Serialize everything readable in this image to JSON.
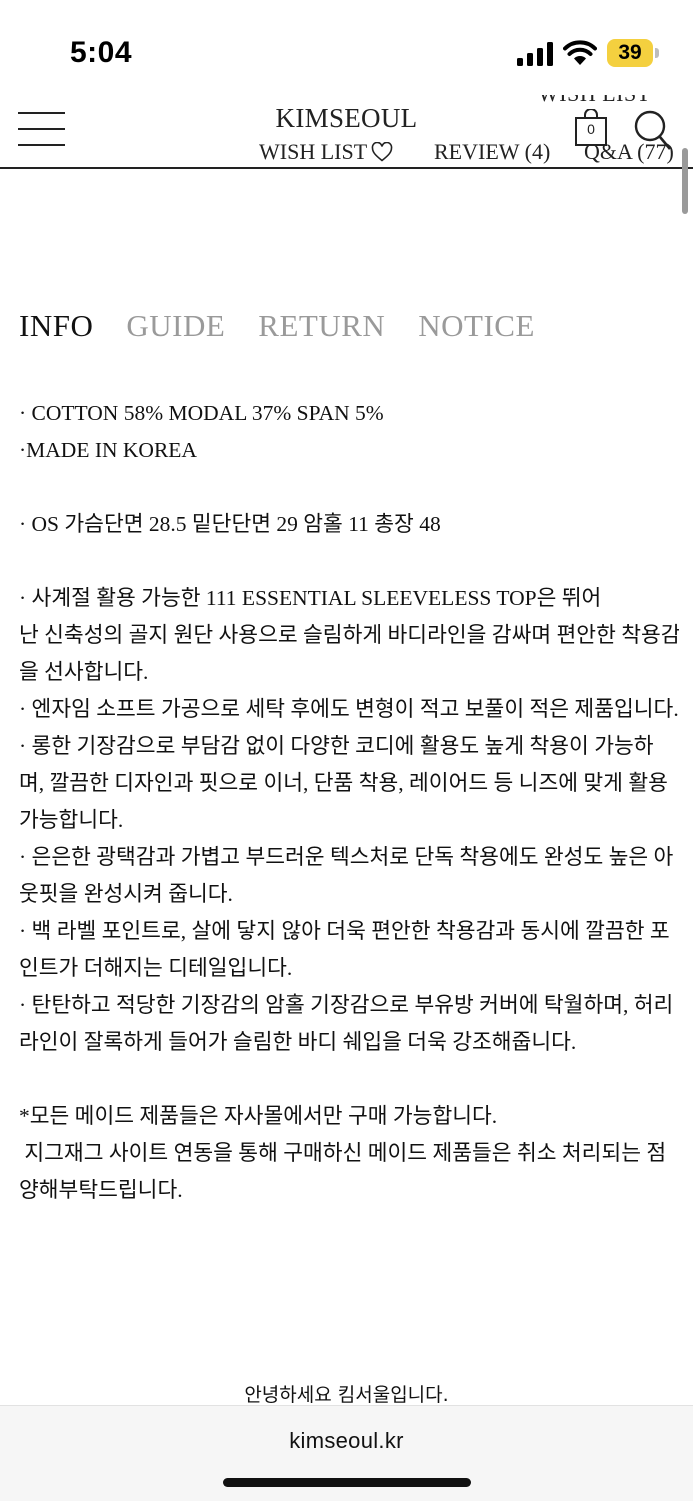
{
  "status_bar": {
    "time": "5:04",
    "battery_level": "39",
    "icons": [
      "signal-icon",
      "wifi-icon",
      "battery-icon"
    ]
  },
  "header": {
    "overflow_label": "WISH LIST",
    "brand": "KIMSEOUL",
    "cart_count": "0",
    "tabs": [
      {
        "label": "WISH LIST"
      },
      {
        "label": "REVIEW (4)"
      },
      {
        "label": "Q&A (77)"
      }
    ],
    "icons": [
      "menu-icon",
      "heart-icon",
      "cart-icon",
      "search-icon"
    ]
  },
  "info_tabs": [
    {
      "label": "INFO",
      "active": true
    },
    {
      "label": "GUIDE",
      "active": false
    },
    {
      "label": "RETURN",
      "active": false
    },
    {
      "label": "NOTICE",
      "active": false
    }
  ],
  "product_info": {
    "lines": [
      "· COTTON 58% MODAL 37% SPAN 5%",
      "·MADE IN KOREA",
      "",
      "· OS 가슴단면 28.5 밑단단면 29 암홀 11  총장 48",
      "",
      "· 사계절 활용 가능한 111 ESSENTIAL SLEEVELESS TOP은 뛰어",
      "난 신축성의 골지 원단 사용으로 슬림하게 바디라인을 감싸며 편안한 착용감",
      "을 선사합니다.",
      "· 엔자임 소프트 가공으로 세탁 후에도 변형이 적고 보풀이 적은 제품입니다.",
      "· 롱한 기장감으로 부담감 없이 다양한 코디에 활용도 높게 착용이 가능하",
      "며, 깔끔한 디자인과 핏으로 이너, 단품 착용, 레이어드 등 니즈에 맞게 활용",
      "가능합니다.",
      "· 은은한 광택감과 가볍고 부드러운 텍스처로 단독 착용에도 완성도 높은 아",
      "웃핏을 완성시켜 줍니다.",
      "· 백 라벨 포인트로, 살에 닿지 않아 더욱 편안한 착용감과 동시에 깔끔한 포",
      "인트가 더해지는 디테일입니다.",
      "· 탄탄하고 적당한 기장감의 암홀 기장감으로 부유방 커버에 탁월하며, 허리",
      "라인이 잘록하게 들어가 슬림한 바디 쉐입을 더욱 강조해줍니다.",
      "",
      "*모든 메이드 제품들은 자사몰에서만 구매 가능합니다.",
      " 지그재그 사이트 연동을 통해 구매하신 메이드 제품들은 취소 처리되는 점",
      "양해부탁드립니다."
    ]
  },
  "footer": {
    "greeting": "안녕하세요 킴서울입니다."
  },
  "browser": {
    "url": "kimseoul.kr"
  }
}
